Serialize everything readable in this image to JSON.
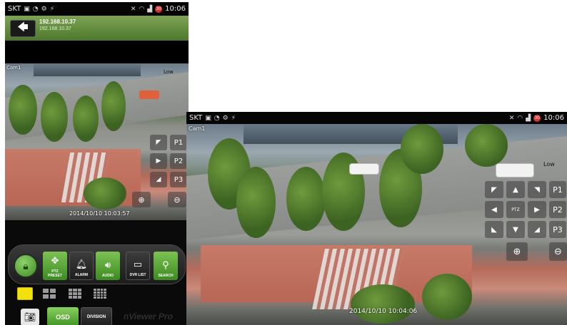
{
  "status_bar": {
    "carrier": "SKT",
    "battery_level": "30",
    "time": "10:06"
  },
  "portrait": {
    "title": "192.168.10.37",
    "subtitle": "192.168.10.37",
    "camera_label": "Cam1",
    "quality_label": "Low",
    "timestamp": "2014/10/10 10:03:57",
    "ptz": {
      "presets": [
        "P1",
        "P2",
        "P3"
      ]
    },
    "toolbar": {
      "ptz_preset": "PTZ\nPRESET",
      "alarm": "ALARM",
      "audio": "AUDIO",
      "dvr_list": "DVR LIST",
      "search": "SEARCH"
    },
    "osd_label": "OSD",
    "division_label": "DIVISION",
    "brand": "nViewer Pro"
  },
  "landscape": {
    "camera_label": "Cam1",
    "quality_label": "Low",
    "timestamp": "2014/10/10 10:04:06",
    "ptz": {
      "center_label": "PTZ",
      "presets": [
        "P1",
        "P2",
        "P3"
      ]
    }
  },
  "icons": {
    "back": "back-arrow-icon",
    "lock": "lock-icon",
    "zoom_in": "zoom-in-icon",
    "zoom_out": "zoom-out-icon",
    "camera": "camera-icon"
  },
  "colors": {
    "accent_green": "#5f8a3a",
    "active_layout": "#f2e10a"
  }
}
